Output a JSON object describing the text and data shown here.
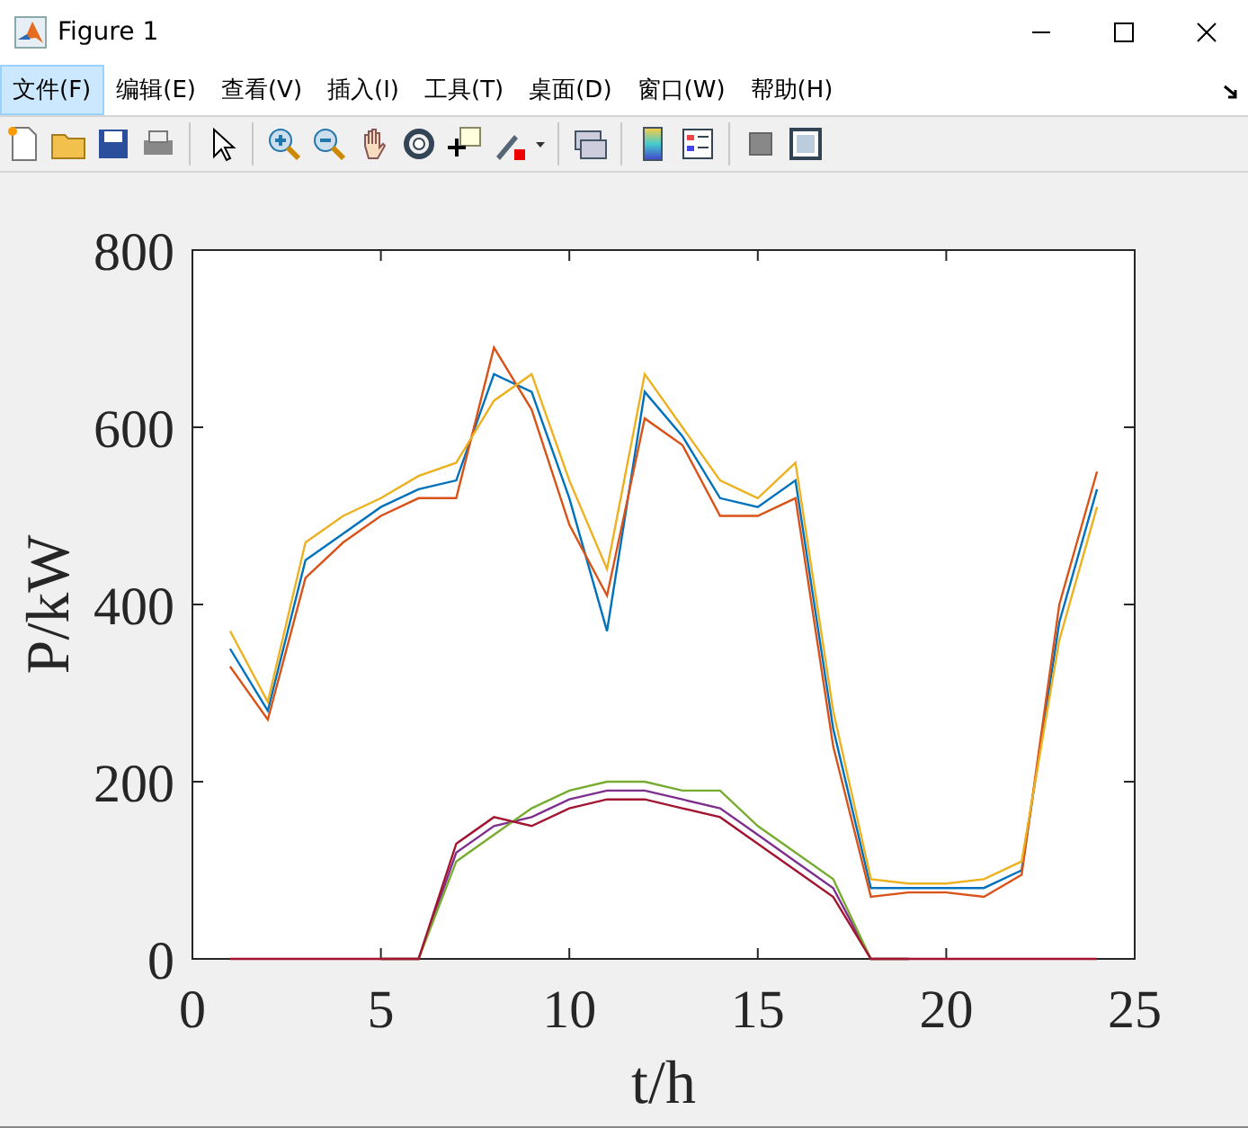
{
  "window": {
    "title": "Figure 1"
  },
  "menu": [
    {
      "label": "文件(F)",
      "selected": true
    },
    {
      "label": "编辑(E)",
      "selected": false
    },
    {
      "label": "查看(V)",
      "selected": false
    },
    {
      "label": "插入(I)",
      "selected": false
    },
    {
      "label": "工具(T)",
      "selected": false
    },
    {
      "label": "桌面(D)",
      "selected": false
    },
    {
      "label": "窗口(W)",
      "selected": false
    },
    {
      "label": "帮助(H)",
      "selected": false
    }
  ],
  "figure": {
    "chart_data": {
      "type": "line",
      "xlabel": "t/h",
      "ylabel": "P/kW",
      "xlim": [
        0,
        25
      ],
      "ylim": [
        0,
        800
      ],
      "xticks": [
        0,
        5,
        10,
        15,
        20,
        25
      ],
      "yticks": [
        0,
        200,
        400,
        600,
        800
      ],
      "x": [
        1,
        2,
        3,
        4,
        5,
        6,
        7,
        8,
        9,
        10,
        11,
        12,
        13,
        14,
        15,
        16,
        17,
        18,
        19,
        20,
        21,
        22,
        23,
        24
      ],
      "series": [
        {
          "color": "#0072bd",
          "values": [
            350,
            280,
            450,
            480,
            510,
            530,
            540,
            660,
            640,
            520,
            370,
            640,
            590,
            520,
            510,
            540,
            260,
            80,
            80,
            80,
            80,
            100,
            380,
            530
          ]
        },
        {
          "color": "#d95319",
          "values": [
            330,
            270,
            430,
            470,
            500,
            520,
            520,
            690,
            620,
            490,
            410,
            610,
            580,
            500,
            500,
            520,
            240,
            70,
            75,
            75,
            70,
            95,
            400,
            550
          ]
        },
        {
          "color": "#edb120",
          "values": [
            370,
            290,
            470,
            500,
            520,
            545,
            560,
            630,
            660,
            540,
            440,
            660,
            600,
            540,
            520,
            560,
            280,
            90,
            85,
            85,
            90,
            110,
            360,
            510
          ]
        },
        {
          "color": "#7e2f8e",
          "values": [
            null,
            null,
            null,
            null,
            0,
            0,
            120,
            150,
            160,
            180,
            190,
            190,
            180,
            170,
            140,
            110,
            80,
            0,
            0,
            null,
            null,
            null,
            null,
            null
          ]
        },
        {
          "color": "#77ac30",
          "values": [
            null,
            null,
            null,
            null,
            0,
            0,
            110,
            140,
            170,
            190,
            200,
            200,
            190,
            190,
            150,
            120,
            90,
            0,
            0,
            null,
            null,
            null,
            null,
            null
          ]
        },
        {
          "color": "#a2142f",
          "values": [
            0,
            0,
            0,
            0,
            0,
            0,
            130,
            160,
            150,
            170,
            180,
            180,
            170,
            160,
            130,
            100,
            70,
            0,
            0,
            0,
            0,
            0,
            0,
            0
          ]
        }
      ]
    }
  }
}
